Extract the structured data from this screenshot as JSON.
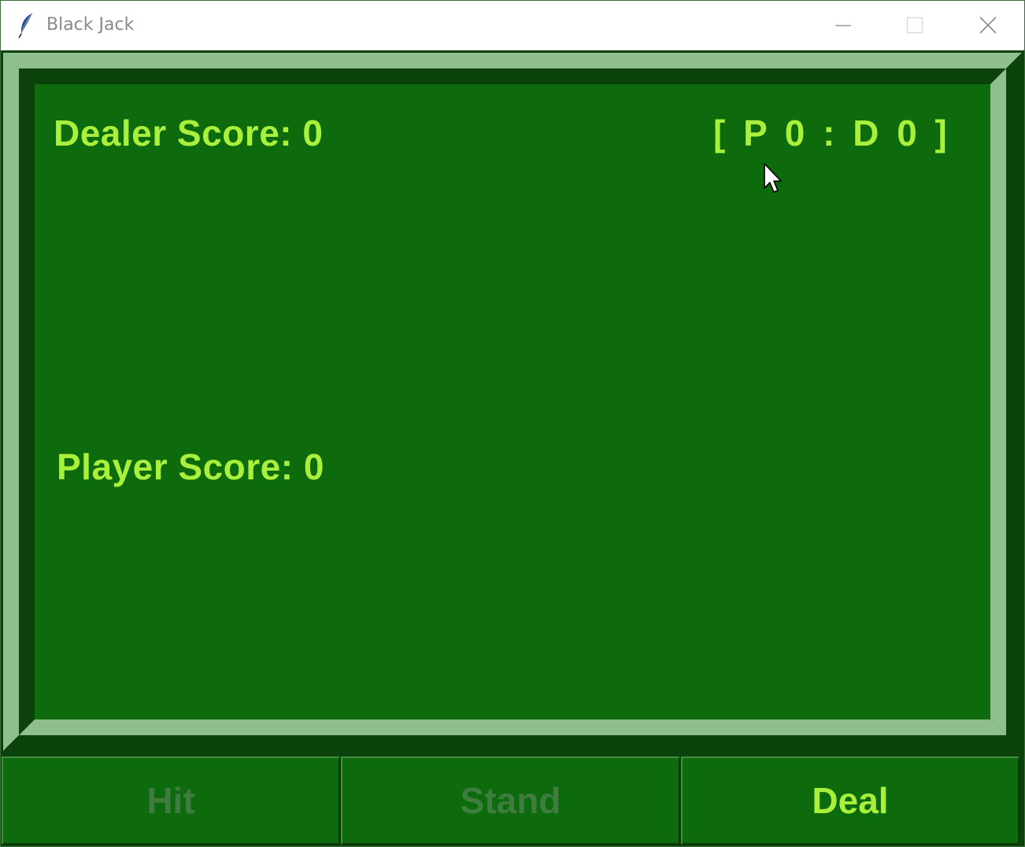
{
  "window": {
    "title": "Black Jack",
    "icon": "feather-icon"
  },
  "table": {
    "dealer_score_label": "Dealer Score: 0",
    "player_score_label": "Player Score: 0",
    "tally_label": "[ P 0 : D 0 ]"
  },
  "buttons": {
    "hit": {
      "label": "Hit",
      "enabled": false
    },
    "stand": {
      "label": "Stand",
      "enabled": false
    },
    "deal": {
      "label": "Deal",
      "enabled": true
    }
  },
  "colors": {
    "felt": "#0d6b0d",
    "text_accent": "#a8f03c",
    "disabled_text": "#3e7d3e",
    "bevel_light": "#8fbf8f",
    "bevel_dark": "#0b420b"
  }
}
